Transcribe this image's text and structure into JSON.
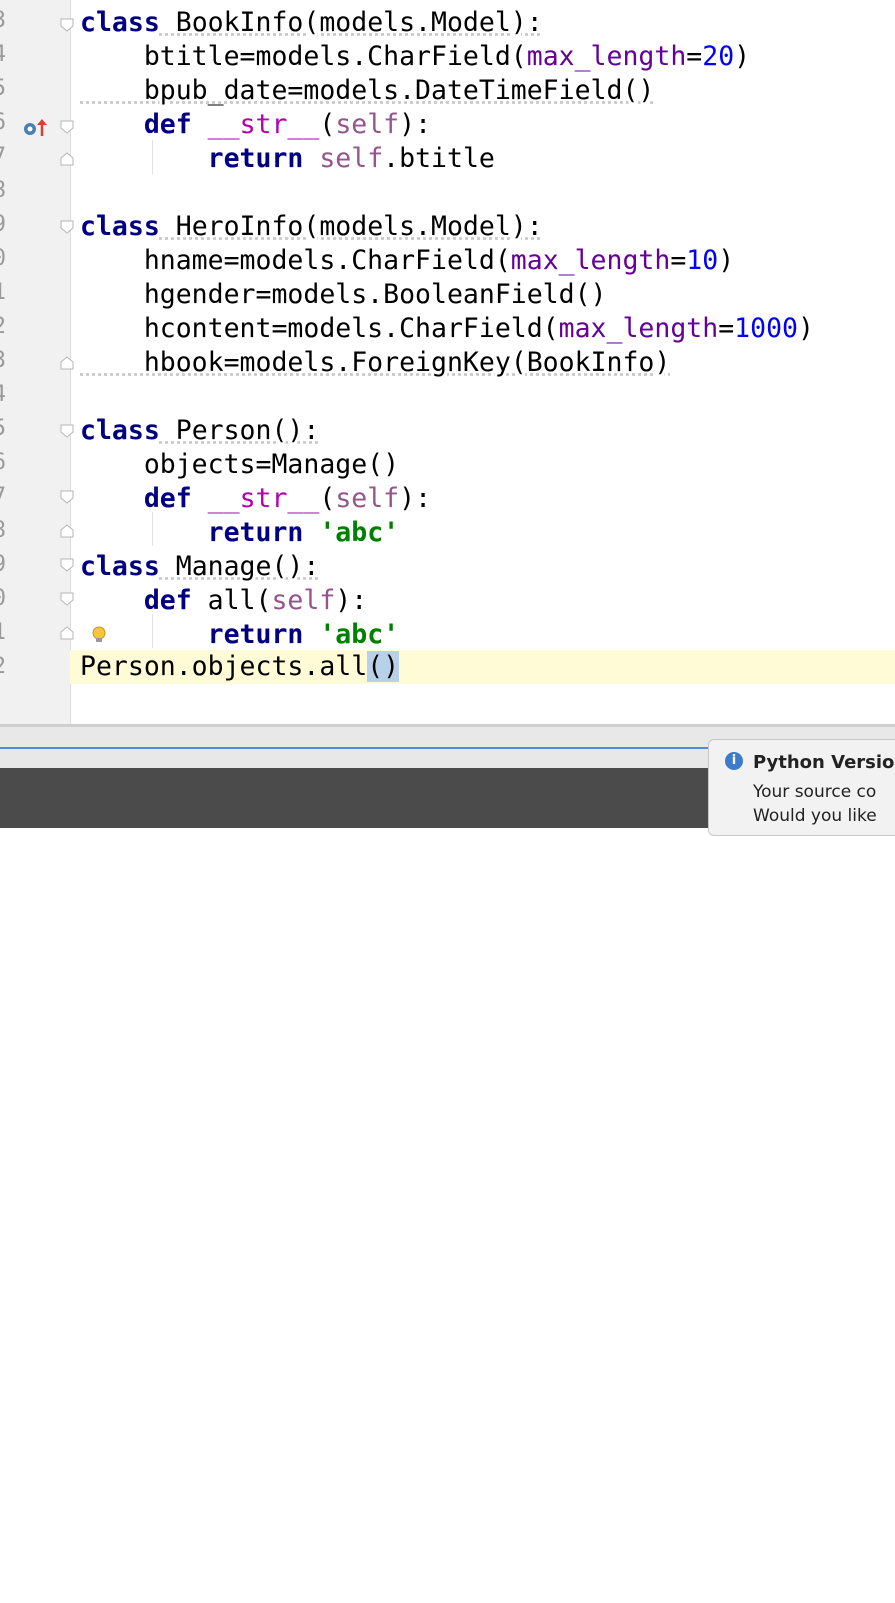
{
  "line_numbers": [
    "3",
    "4",
    "5",
    "6",
    "7",
    "8",
    "9",
    "0",
    "1",
    "2",
    "3",
    "4",
    "5",
    "6",
    "7",
    "8",
    "9",
    "0",
    "1",
    "2"
  ],
  "code": {
    "l1": {
      "kw": "class",
      "rest": " BookInfo(models.Model):"
    },
    "l2": {
      "a": "    btitle=models.CharField(",
      "kwarg": "max_length",
      "eq": "=",
      "num": "20",
      "end": ")"
    },
    "l3": {
      "a": "    bpub_date=models.DateTimeField()"
    },
    "l4": {
      "kw": "    def",
      "sp": " ",
      "mag": "__str__",
      "b": "(",
      "self": "self",
      "end": "):"
    },
    "l5": {
      "kw": "        return",
      "sp": " ",
      "self": "self",
      "end": ".btitle"
    },
    "l7": {
      "kw": "class",
      "rest": " HeroInfo(models.Model):"
    },
    "l8": {
      "a": "    hname=models.CharField(",
      "kwarg": "max_length",
      "eq": "=",
      "num": "10",
      "end": ")"
    },
    "l9": {
      "a": "    hgender=models.BooleanField()"
    },
    "l10": {
      "a": "    hcontent=models.CharField(",
      "kwarg": "max_length",
      "eq": "=",
      "num": "1000",
      "end": ")"
    },
    "l11": {
      "a": "    hbook=models.ForeignKey(BookInfo)"
    },
    "l13": {
      "kw": "class",
      "rest": " Person():"
    },
    "l14": {
      "a": "    objects=Manage()"
    },
    "l15": {
      "kw": "    def",
      "sp": " ",
      "mag": "__str__",
      "b": "(",
      "self": "self",
      "end": "):"
    },
    "l16": {
      "kw": "        return",
      "sp": " ",
      "str": "'abc'"
    },
    "l17": {
      "kw": "class",
      "rest": " Manage():"
    },
    "l18": {
      "kw": "    def",
      "a": " all(",
      "self": "self",
      "end": "):"
    },
    "l19": {
      "kw": "        return",
      "sp": " ",
      "str": "'abc'"
    },
    "l20": {
      "a": "Person.objects.",
      "b": "all",
      "hl": "()"
    }
  },
  "popup": {
    "title": "Python Versio",
    "line1": "Your source co",
    "line2": "Would you like"
  },
  "colors": {
    "keyword": "#000080",
    "kwarg": "#660099",
    "number": "#0000ff",
    "string": "#008000",
    "self": "#94558d"
  }
}
